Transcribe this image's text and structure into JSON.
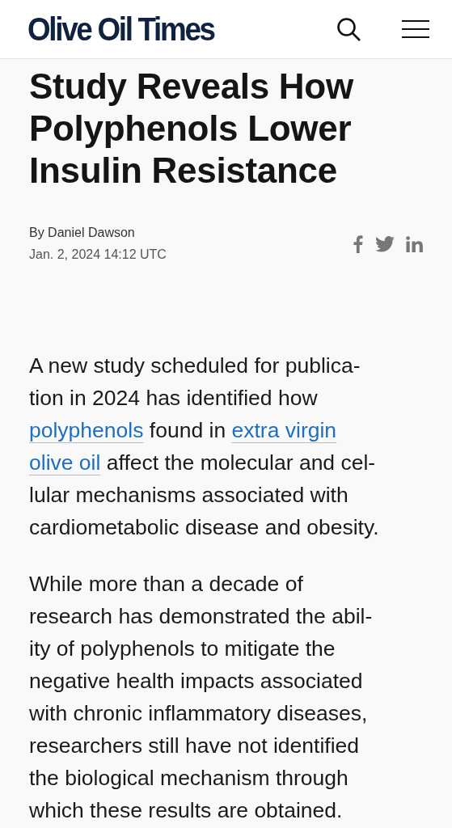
{
  "header": {
    "logo": "Olive Oil Times"
  },
  "article": {
    "title": "Study Reveals How Polyphenols Lower Insulin Resistance",
    "byline": "By Daniel Dawson",
    "date": "Jan. 2, 2024 14:12 UTC",
    "share": [
      {
        "kind": "facebook"
      },
      {
        "kind": "twitter"
      },
      {
        "kind": "linkedin"
      }
    ],
    "paragraphs": [
      [
        {
          "text": "A new study scheduled for publica-\ntion in 2024 has identified how\n",
          "link": false
        },
        {
          "text": "polyphenols",
          "link": true
        },
        {
          "text": " found in ",
          "link": false
        },
        {
          "text": "extra virgin",
          "link": true
        },
        {
          "text": "olive oil",
          "link": true,
          "line_start": true
        },
        {
          "text": " affect the molecular and cel-\nlular mechanisms associated with\ncardiometabolic disease and obesity.",
          "link": false
        }
      ],
      [
        {
          "text": "While more than a decade of\nresearch has demonstrated the abil-\nity of polyphenols to mitigate the\nnegative health impacts associated\nwith chronic inflammatory diseases,\nresearchers still have not identified\nthe biological mechanism through\nwhich these results are obtained.",
          "link": false
        }
      ]
    ]
  }
}
